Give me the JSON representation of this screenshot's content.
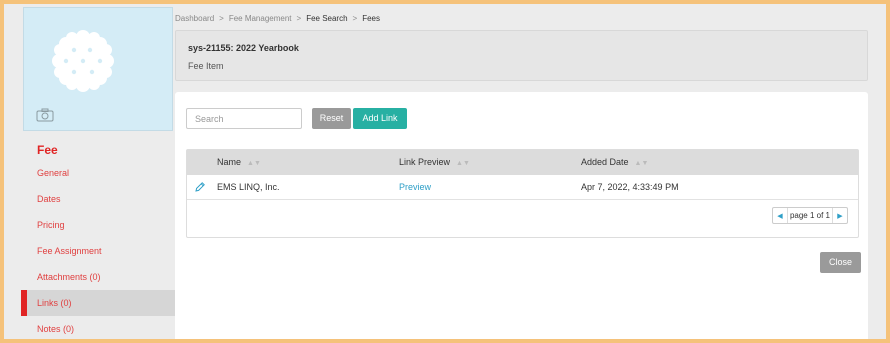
{
  "breadcrumb": {
    "items": [
      "Dashboard",
      "Fee Management",
      "Fee Search",
      "Fees"
    ],
    "separator": ">"
  },
  "header": {
    "title": "sys-21155: 2022 Yearbook",
    "subtitle": "Fee Item"
  },
  "sidebar": {
    "section_title": "Fee",
    "items": [
      {
        "label": "General"
      },
      {
        "label": "Dates"
      },
      {
        "label": "Pricing"
      },
      {
        "label": "Fee Assignment"
      },
      {
        "label": "Attachments (0)"
      },
      {
        "label": "Links (0)",
        "active": true
      },
      {
        "label": "Notes (0)"
      }
    ]
  },
  "toolbar": {
    "search_placeholder": "Search",
    "reset_label": "Reset",
    "add_link_label": "Add Link"
  },
  "table": {
    "columns": [
      "Name",
      "Link Preview",
      "Added Date"
    ],
    "rows": [
      {
        "name": "EMS LINQ, Inc.",
        "preview": "Preview",
        "added": "Apr 7, 2022, 4:33:49 PM"
      }
    ]
  },
  "pager": {
    "label": "page 1 of 1"
  },
  "footer": {
    "close_label": "Close"
  },
  "colors": {
    "accent_red": "#e02424",
    "teal": "#27b0a3",
    "link_blue": "#2e9fc7",
    "frame": "#f5c27a"
  }
}
